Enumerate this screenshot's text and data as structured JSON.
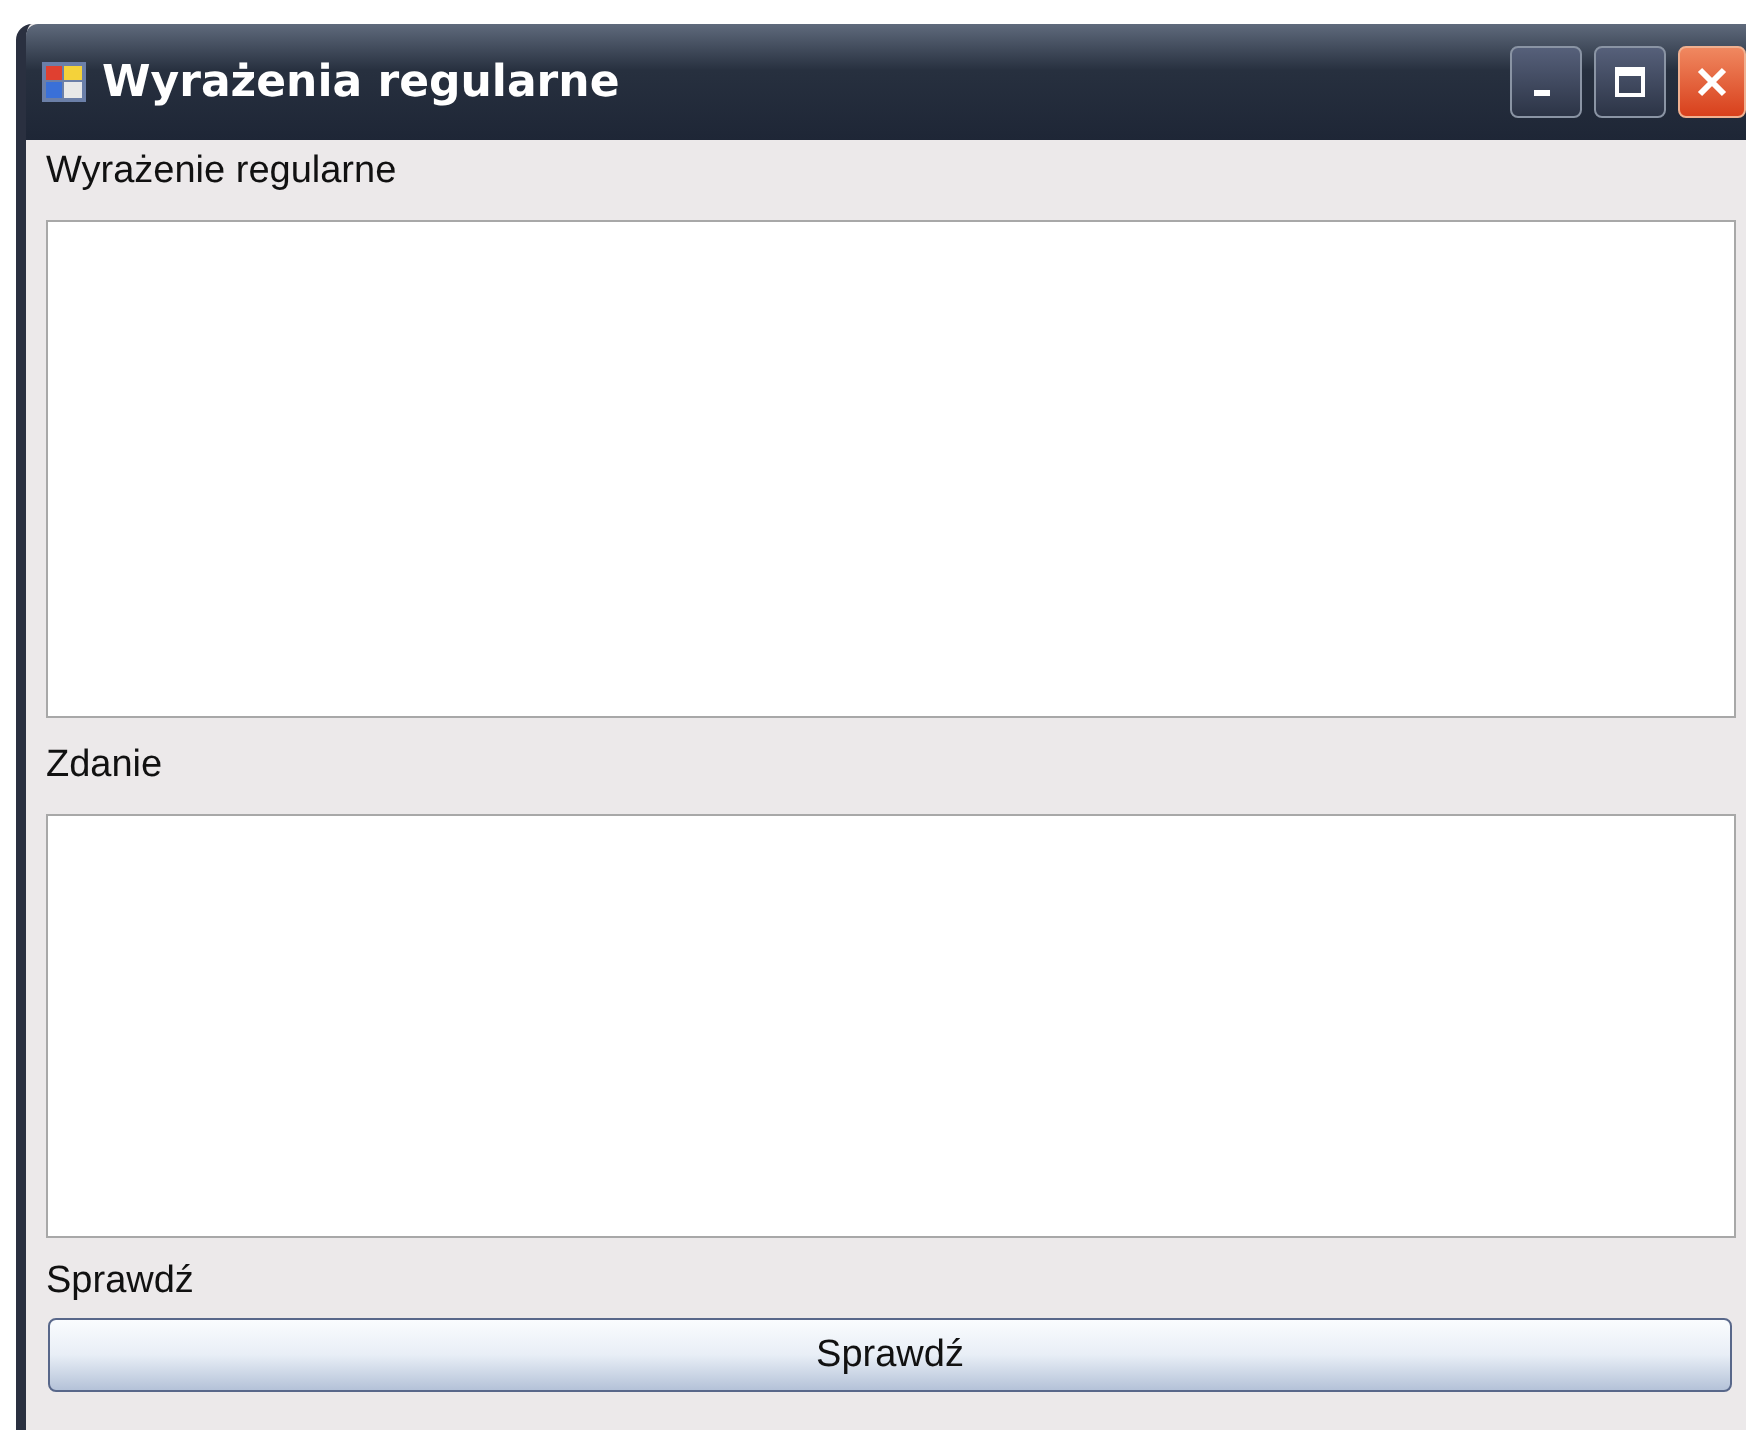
{
  "window": {
    "title": "Wyrażenia regularne"
  },
  "fields": [
    {
      "label": "Wyrażenie regularne"
    },
    {
      "label": "Zdanie"
    }
  ],
  "result_label": "Sprawdź",
  "button": "Sprawdź"
}
